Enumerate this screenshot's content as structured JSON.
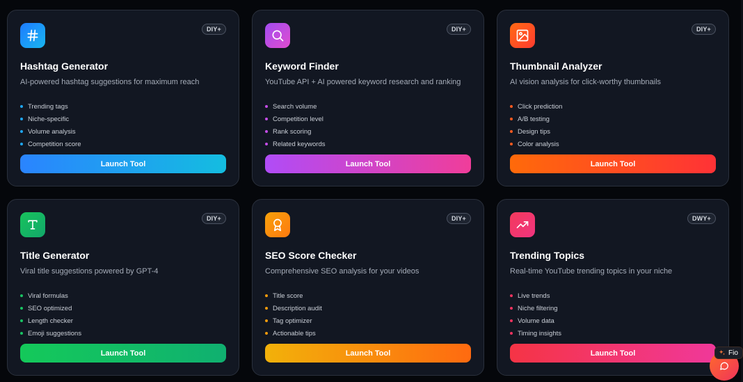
{
  "tools": [
    {
      "icon": "hash-icon",
      "tile_gradient": [
        "#1e7bff",
        "#18b6f0"
      ],
      "badge": "DIY+",
      "title": "Hashtag Generator",
      "description": "AI-powered hashtag suggestions for maximum reach",
      "features": [
        "Trending tags",
        "Niche-specific",
        "Volume analysis",
        "Competition score"
      ],
      "bullet_color": "#1ea7f5",
      "button_label": "Launch Tool",
      "button_gradient": [
        "#2a84ff",
        "#14bde0"
      ]
    },
    {
      "icon": "search-icon",
      "tile_gradient": [
        "#a14cf0",
        "#e14ccf"
      ],
      "badge": "DIY+",
      "title": "Keyword Finder",
      "description": "YouTube API + AI powered keyword research and ranking",
      "features": [
        "Search volume",
        "Competition level",
        "Rank scoring",
        "Related keywords"
      ],
      "bullet_color": "#c64de8",
      "button_label": "Launch Tool",
      "button_gradient": [
        "#b04cf7",
        "#f03d9a"
      ]
    },
    {
      "icon": "image-icon",
      "tile_gradient": [
        "#ff6a14",
        "#ff3b2f"
      ],
      "badge": "DIY+",
      "title": "Thumbnail Analyzer",
      "description": "AI vision analysis for click-worthy thumbnails",
      "features": [
        "Click prediction",
        "A/B testing",
        "Design tips",
        "Color analysis"
      ],
      "bullet_color": "#ff5a1f",
      "button_label": "Launch Tool",
      "button_gradient": [
        "#ff6a0a",
        "#ff3236"
      ]
    },
    {
      "icon": "type-icon",
      "tile_gradient": [
        "#18c25c",
        "#12a86a"
      ],
      "badge": "DIY+",
      "title": "Title Generator",
      "description": "Viral title suggestions powered by GPT-4",
      "features": [
        "Viral formulas",
        "SEO optimized",
        "Length checker",
        "Emoji suggestions"
      ],
      "bullet_color": "#19c463",
      "button_label": "Launch Tool",
      "button_gradient": [
        "#14c95a",
        "#10b070"
      ]
    },
    {
      "icon": "award-icon",
      "tile_gradient": [
        "#f6a10a",
        "#ff7a10"
      ],
      "badge": "DIY+",
      "title": "SEO Score Checker",
      "description": "Comprehensive SEO analysis for your videos",
      "features": [
        "Title score",
        "Description audit",
        "Tag optimizer",
        "Actionable tips"
      ],
      "bullet_color": "#f59b0c",
      "button_label": "Launch Tool",
      "button_gradient": [
        "#f2b10a",
        "#ff6a10"
      ]
    },
    {
      "icon": "trending-up-icon",
      "tile_gradient": [
        "#f33a5c",
        "#f0347f"
      ],
      "badge": "DWY+",
      "title": "Trending Topics",
      "description": "Real-time YouTube trending topics in your niche",
      "features": [
        "Live trends",
        "Niche filtering",
        "Volume data",
        "Timing insights"
      ],
      "bullet_color": "#f2335f",
      "button_label": "Launch Tool",
      "button_gradient": [
        "#f53445",
        "#f0389a"
      ]
    }
  ],
  "chat": {
    "label": "Fio",
    "label_icon": "sparkle-icon",
    "button_icon": "chat-bubble-icon"
  }
}
